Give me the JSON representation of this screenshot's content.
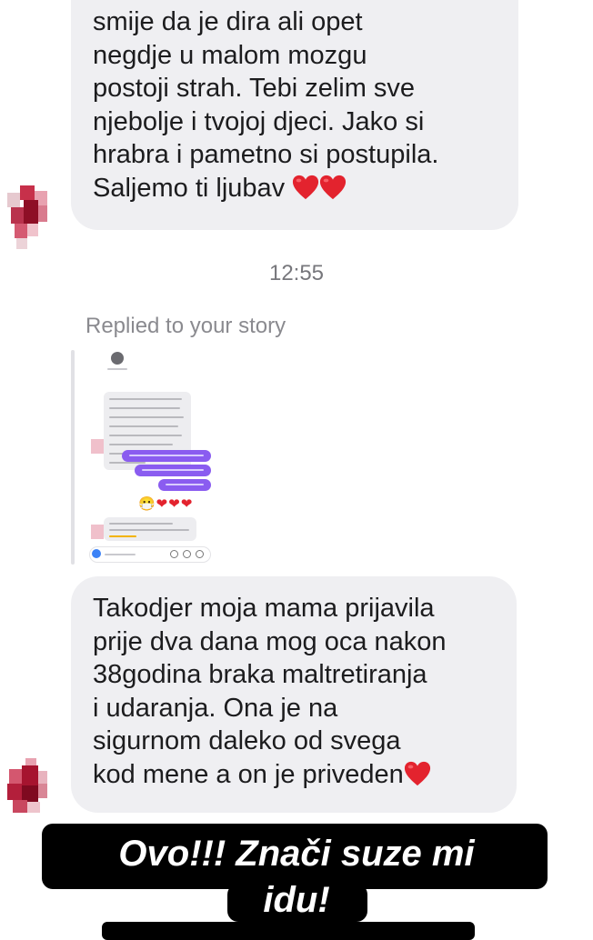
{
  "messages": {
    "first": {
      "lines": [
        "smije da je dira ali opet",
        "negdje u malom mozgu",
        "postoji strah. Tebi zelim sve",
        "njebolje i tvojoj djeci. Jako si",
        "hrabra i pametno si postupila.",
        "Saljemo ti ljubav"
      ]
    },
    "timestamp": "12:55",
    "replied_label": "Replied to your story",
    "second": {
      "lines": [
        "Takodjer moja mama prijavila",
        "prije dva dana mog oca nakon",
        "38godina braka maltretiranja",
        "i udaranja. Ona je na",
        "sigurnom daleko od svega",
        "kod mene a on je priveden"
      ]
    }
  },
  "caption": {
    "line1": "Ovo!!! Znači suze mi",
    "line2": "idu!"
  },
  "icons": {
    "heart": "red-heart-icon",
    "avatar": "pixelated-avatar"
  },
  "colors": {
    "bubble": "#efeff2",
    "heart": "#e3232e",
    "story_accent": "#8a5cf0",
    "caption_bg": "#000000",
    "caption_text": "#ffffff"
  }
}
